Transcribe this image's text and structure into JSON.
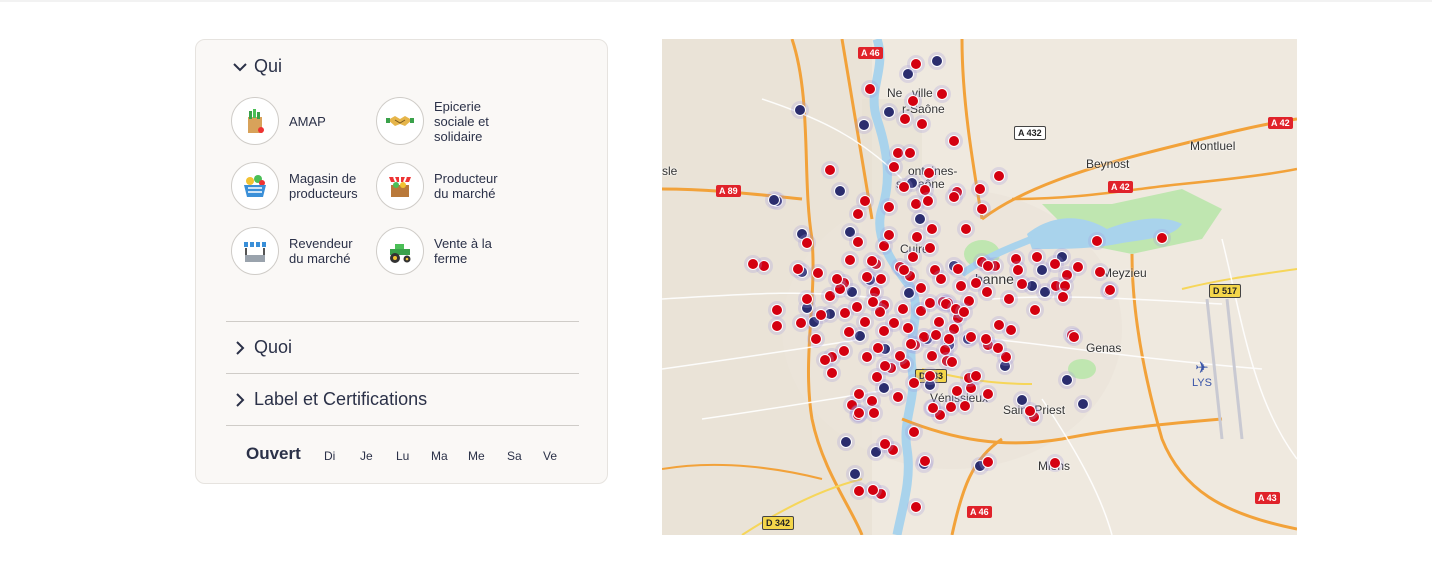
{
  "filters": {
    "qui": {
      "title": "Qui",
      "expanded": true,
      "categories": [
        {
          "label": "AMAP",
          "icon": "vegetable-bag-icon"
        },
        {
          "label": "Epicerie\nsociale et\nsolidaire",
          "icon": "handshake-icon"
        },
        {
          "label": "Magasin de\nproducteurs",
          "icon": "basket-icon"
        },
        {
          "label": "Producteur\ndu marché",
          "icon": "produce-crate-icon"
        },
        {
          "label": "Revendeur\ndu marché",
          "icon": "market-stall-icon"
        },
        {
          "label": "Vente à la\nferme",
          "icon": "tractor-icon"
        }
      ]
    },
    "quoi": {
      "title": "Quoi",
      "expanded": false
    },
    "labels": {
      "title": "Label et Certifications",
      "expanded": false
    },
    "ouvert": {
      "title": "Ouvert",
      "days": [
        "Di",
        "Je",
        "Lu",
        "Ma",
        "Me",
        "Sa",
        "Ve"
      ]
    }
  },
  "map": {
    "places": [
      "Neuville-sur-Saône",
      "Fontaines-sur-Saône",
      "Caluire-et-Cuire",
      "Villeurbanne",
      "Beynost",
      "Montluel",
      "Meyzieu",
      "Genas",
      "Vénissieux",
      "Saint-Priest",
      "Mions",
      "sle"
    ],
    "visible_place_labels": {
      "neuville_a": "Ne",
      "neuville_b": "ville",
      "neuville_c": "r-Saône",
      "fontaines_a": "ontaines-",
      "fontaines_b": "s",
      "fontaines_c": "aône",
      "caluire": "Cuire",
      "villeurbanne": "banne",
      "beynost": "Beynost",
      "montluel": "Montluel",
      "meyzieu": "Meyzieu",
      "genas": "Genas",
      "venissieux": "Vénissieux",
      "saint_priest": "Saint-Priest",
      "mions": "Mions",
      "sle": "sle"
    },
    "roads": [
      {
        "label": "A 46",
        "style": "red"
      },
      {
        "label": "A 432",
        "style": "white"
      },
      {
        "label": "A 42",
        "style": "red"
      },
      {
        "label": "A 42",
        "style": "red"
      },
      {
        "label": "A 89",
        "style": "red"
      },
      {
        "label": "D 517",
        "style": "yellow"
      },
      {
        "label": "D 383",
        "style": "yellow"
      },
      {
        "label": "D 342",
        "style": "yellow"
      },
      {
        "label": "A 46",
        "style": "red"
      },
      {
        "label": "A 43",
        "style": "red"
      }
    ],
    "airport": "LYS",
    "colors": {
      "red_marker": "#d40010",
      "navy_marker": "#2b2d6e",
      "water": "#a9d3ec",
      "park": "#bfe6b0",
      "highway": "#f2a23a"
    }
  }
}
